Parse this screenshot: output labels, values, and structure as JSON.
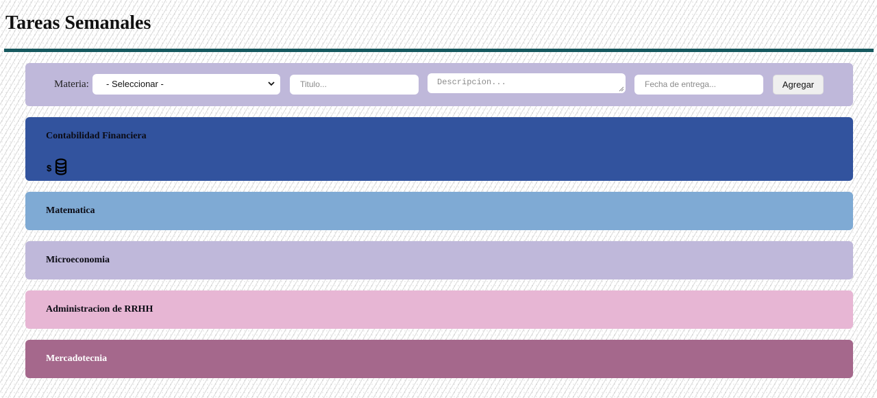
{
  "header": {
    "title": "Tareas Semanales"
  },
  "form": {
    "subject_label": "Materia:",
    "subject_select": {
      "selected": "- Seleccionar -"
    },
    "title_placeholder": "Titulo...",
    "description_placeholder": "Descripcion...",
    "due_date_placeholder": "Fecha de entrega...",
    "add_button_label": "Agregar"
  },
  "subjects": [
    {
      "name": "Contabilidad Financiera",
      "color": "#32539e",
      "icon": "money-coins-icon"
    },
    {
      "name": "Matematica",
      "color": "#7faad4"
    },
    {
      "name": "Microeconomia",
      "color": "#bfb8da"
    },
    {
      "name": "Administracion de RRHH",
      "color": "#e7b6d4"
    },
    {
      "name": "Mercadotecnia",
      "color": "#a5688c"
    }
  ],
  "colors": {
    "title_rule": "#17595f",
    "form_background": "#bfb8da"
  }
}
